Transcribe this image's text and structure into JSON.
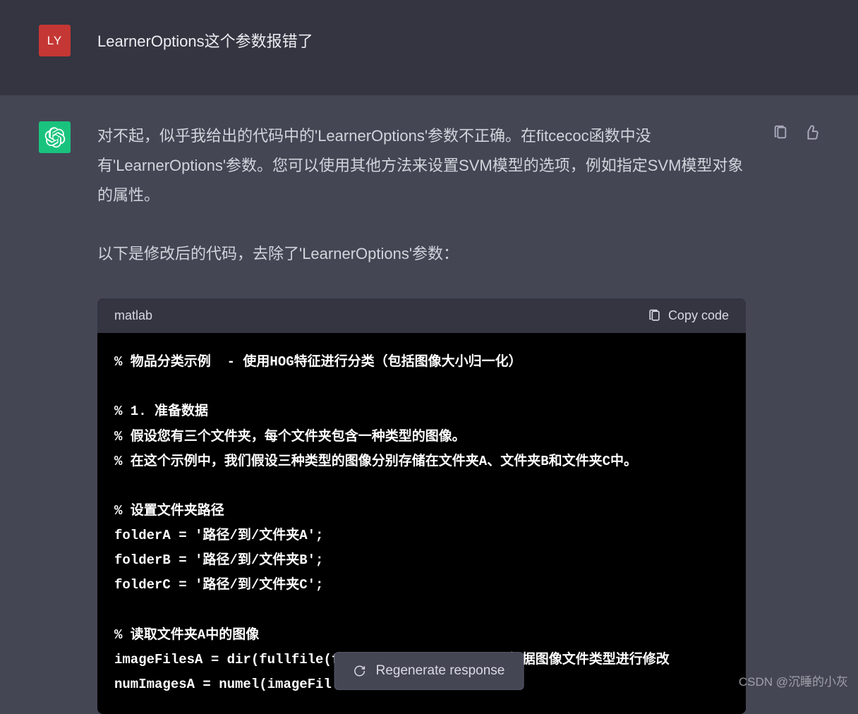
{
  "user": {
    "avatar_initials": "LY",
    "message": "LearnerOptions这个参数报错了"
  },
  "assistant": {
    "paragraph1": "对不起，似乎我给出的代码中的'LearnerOptions'参数不正确。在fitcecoc函数中没有'LearnerOptions'参数。您可以使用其他方法来设置SVM模型的选项，例如指定SVM模型对象的属性。",
    "paragraph2": "以下是修改后的代码，去除了'LearnerOptions'参数："
  },
  "code": {
    "language": "matlab",
    "copy_label": "Copy code",
    "lines": {
      "l1": "% 物品分类示例  - 使用HOG特征进行分类（包括图像大小归一化）",
      "l2": "",
      "l3": "% 1. 准备数据",
      "l4": "% 假设您有三个文件夹，每个文件夹包含一种类型的图像。",
      "l5": "% 在这个示例中，我们假设三种类型的图像分别存储在文件夹A、文件夹B和文件夹C中。",
      "l6": "",
      "l7": "% 设置文件夹路径",
      "l8": "folderA = '路径/到/文件夹A';",
      "l9": "folderB = '路径/到/文件夹B';",
      "l10": "folderC = '路径/到/文件夹C';",
      "l11": "",
      "l12": "% 读取文件夹A中的图像",
      "l13a": "imageFilesA = dir(fullfile(folderA, '*.jpg')); ",
      "l13b": "% 根据图像文件类型进行修改",
      "l14": "numImagesA = numel(imageFil"
    }
  },
  "regenerate_label": "Regenerate response",
  "watermark": "CSDN @沉睡的小灰"
}
